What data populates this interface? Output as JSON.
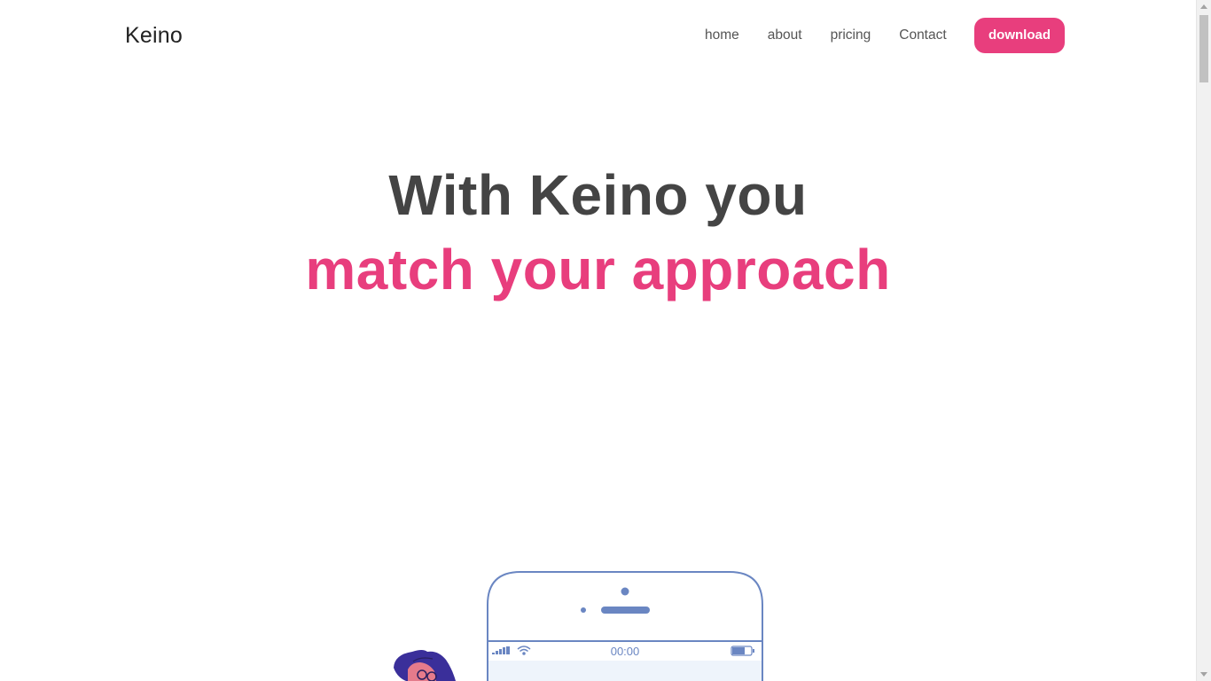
{
  "brand": {
    "name": "Keino"
  },
  "nav": {
    "links": [
      {
        "label": "home"
      },
      {
        "label": "about"
      },
      {
        "label": "pricing"
      },
      {
        "label": "Contact"
      }
    ],
    "download_label": "download"
  },
  "hero": {
    "line1": "With Keino you",
    "line2": "match your approach"
  },
  "phone": {
    "time": "00:00"
  },
  "colors": {
    "accent": "#e83e7d",
    "heading": "#444444",
    "phone_outline": "#6a86c2",
    "character_hair": "#3a2f9a"
  },
  "icons": [
    "signal-bars-icon",
    "wifi-icon",
    "battery-icon",
    "scroll-up-icon",
    "scroll-down-icon"
  ]
}
